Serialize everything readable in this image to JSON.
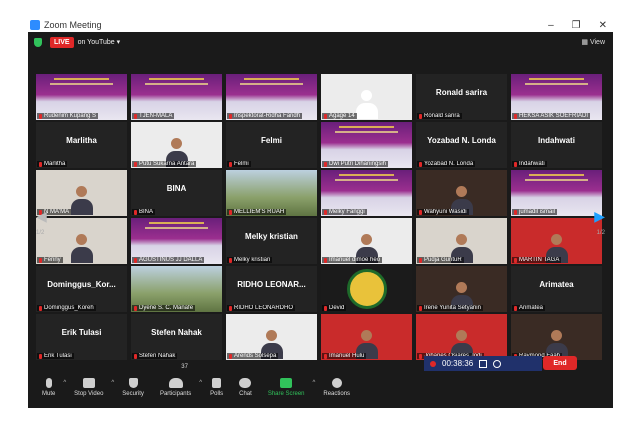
{
  "window": {
    "title": "Zoom Meeting",
    "controls": [
      "–",
      "❐",
      "✕"
    ]
  },
  "topbar": {
    "live_badge": "LIVE",
    "live_destination": "on YouTube ▾",
    "view_label": "View"
  },
  "pager": {
    "left": "1/2",
    "right": "1/2"
  },
  "participants": [
    {
      "name": "Rudenim Kupang S",
      "video": "banner",
      "active": true
    },
    {
      "name": "TJEN-MALA",
      "video": "banner"
    },
    {
      "name": "Inspektorat-Ridha Faridh",
      "video": "banner"
    },
    {
      "name": "Agage 14",
      "video": "silhouette"
    },
    {
      "name": "Ronald sarira",
      "big": "Ronald sarira"
    },
    {
      "name": "HEKSA ASIK SOEFRIADI",
      "video": "banner"
    },
    {
      "name": "Marlitha",
      "big": "Marlitha"
    },
    {
      "name": "Putu Sukarna Antara",
      "video": "photo"
    },
    {
      "name": "Felmi",
      "big": "Felmi"
    },
    {
      "name": "Dwi Putri Dihaningsih",
      "video": "banner"
    },
    {
      "name": "Yozabad N. Londa",
      "big": "Yozabad N. Londa"
    },
    {
      "name": "Indahwati",
      "big": "Indahwati"
    },
    {
      "name": "N MA'MA",
      "video": "room"
    },
    {
      "name": "BINA",
      "big": "BINA"
    },
    {
      "name": "MELLIEM'S RUAH",
      "video": "outdoor"
    },
    {
      "name": "Melky Fanggi",
      "video": "banner"
    },
    {
      "name": "Wahyuni Wasidi",
      "video": "dark"
    },
    {
      "name": "jumadil ismail",
      "video": "banner"
    },
    {
      "name": "Fenny",
      "video": "room"
    },
    {
      "name": "AGUSTINUS JJ DALLA",
      "video": "banner"
    },
    {
      "name": "Melky kristian",
      "big": "Melky kristian"
    },
    {
      "name": "Imanuel dimoe heo",
      "video": "photo"
    },
    {
      "name": "Pudja GuntuR",
      "video": "room"
    },
    {
      "name": "MARTIN TAGA",
      "video": "red"
    },
    {
      "name": "Dominggus_Koreh",
      "big": "Dominggus_Kor..."
    },
    {
      "name": "Dyene S. C. Manafe",
      "video": "outdoor"
    },
    {
      "name": "RIDHO LEONARDHO",
      "big": "RIDHO LEONAR..."
    },
    {
      "name": "Devid",
      "video": "logo"
    },
    {
      "name": "Irene Yunita Setyanin",
      "video": "dark"
    },
    {
      "name": "Arimatea",
      "big": "Arimatea"
    },
    {
      "name": "Erik Tulasi",
      "big": "Erik Tulasi"
    },
    {
      "name": "Stefen Nahak",
      "big": "Stefen Nahak"
    },
    {
      "name": "Arends Solsepa",
      "video": "photo"
    },
    {
      "name": "Imanuel Hulu",
      "video": "red"
    },
    {
      "name": "Johanes Osiares Jodi",
      "video": "red"
    },
    {
      "name": "Raymond Faah",
      "video": "dark"
    }
  ],
  "toolbar": {
    "mute": "Mute",
    "stop_video": "Stop Video",
    "security": "Security",
    "participants": "Participants",
    "participants_count": "37",
    "polls": "Polls",
    "chat": "Chat",
    "share_screen": "Share Screen",
    "reactions": "Reactions"
  },
  "recording": {
    "elapsed": "00:38:36"
  },
  "end_button": "End",
  "colors": {
    "accent": "#2d8cff",
    "live": "#e02828",
    "share": "#31c25b",
    "active_speaker": "#f2e200"
  }
}
